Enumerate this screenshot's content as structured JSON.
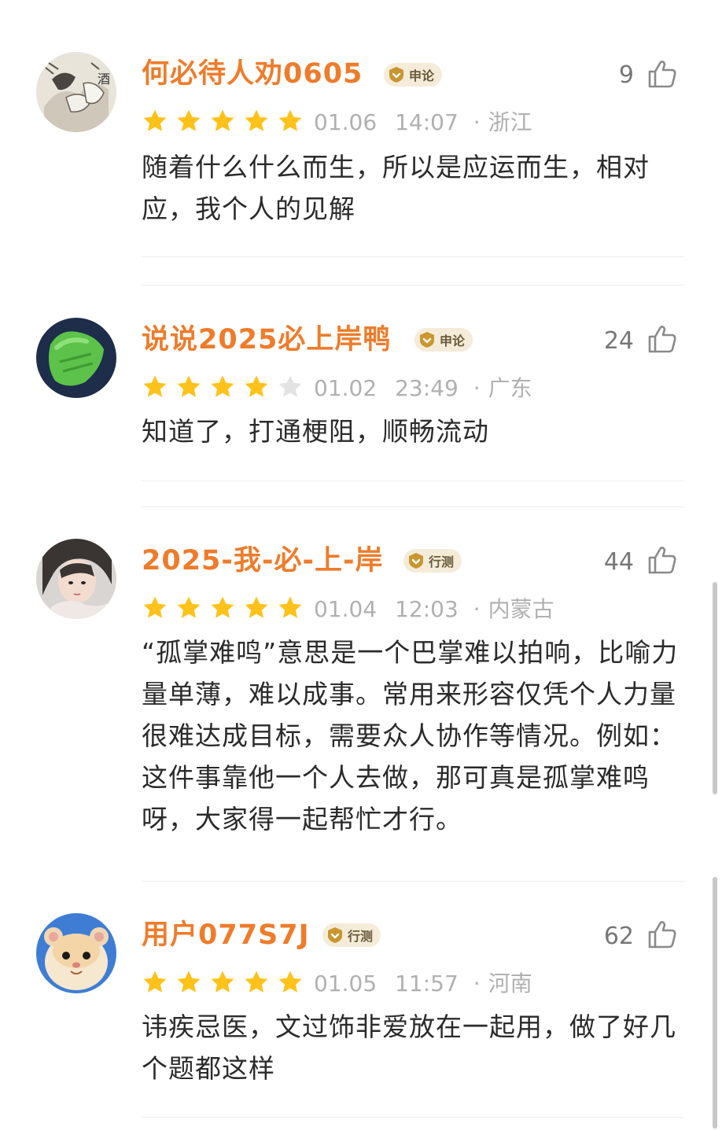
{
  "comments": [
    {
      "username": "何必待人劝0605",
      "badge": "申论",
      "likes": "9",
      "rating": 5,
      "date": "01.06",
      "time": "14:07",
      "location": "浙江",
      "text": "随着什么什么而生，所以是应运而生，相对应，我个人的见解"
    },
    {
      "username": "说说2025必上岸鸭",
      "badge": "申论",
      "likes": "24",
      "rating": 4,
      "date": "01.02",
      "time": "23:49",
      "location": "广东",
      "text": "知道了，打通梗阻，顺畅流动"
    },
    {
      "username": "2025-我-必-上-岸",
      "badge": "行测",
      "likes": "44",
      "rating": 5,
      "date": "01.04",
      "time": "12:03",
      "location": "内蒙古",
      "text": "“孤掌难鸣”意思是一个巴掌难以拍响，比喻力量单薄，难以成事。常用来形容仅凭个人力量很难达成目标，需要众人协作等情况。例如：这件事靠他一个人去做，那可真是孤掌难鸣呀，大家得一起帮忙才行。"
    },
    {
      "username": "用户077S7J",
      "badge": "行测",
      "likes": "62",
      "rating": 5,
      "date": "01.05",
      "time": "11:57",
      "location": "河南",
      "text": "讳疾忌医，文过饰非爱放在一起用，做了好几个题都这样"
    }
  ],
  "separator": "·",
  "icons": {
    "like": "thumbs-up-icon",
    "star": "star-icon",
    "badge": "shield-badge-icon"
  },
  "colors": {
    "username": "#ee7c2b",
    "star_filled": "#ffc21a",
    "star_empty": "#e3e3e3",
    "meta": "#b0b0b0",
    "like": "#777777"
  }
}
